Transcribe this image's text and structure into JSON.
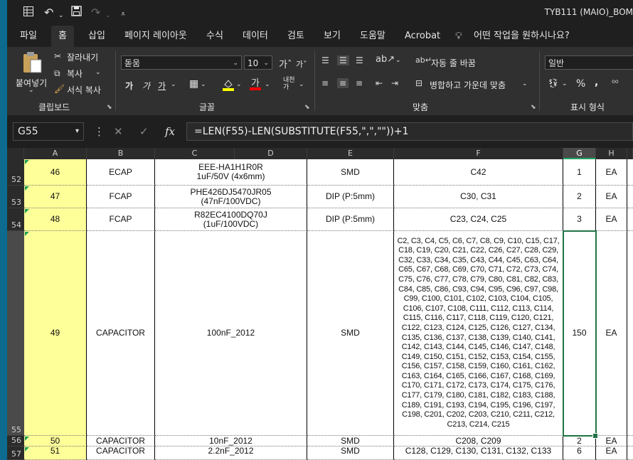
{
  "window": {
    "title": "TYB111 (MAIO)_BOM"
  },
  "quick_access": {
    "save_icon": "save-icon",
    "undo_icon": "undo-icon",
    "redo_icon": "redo-icon"
  },
  "tabs": [
    "파일",
    "홈",
    "삽입",
    "페이지 레이아웃",
    "수식",
    "데이터",
    "검토",
    "보기",
    "도움말",
    "Acrobat"
  ],
  "active_tab": "홈",
  "tell_me": "어떤 작업을 원하시나요?",
  "ribbon": {
    "clipboard": {
      "label": "클립보드",
      "paste": "붙여넣기",
      "cut": "잘라내기",
      "copy": "복사",
      "format_painter": "서식 복사"
    },
    "font": {
      "label": "글꼴",
      "font_name": "돋움",
      "font_size": "10"
    },
    "alignment": {
      "label": "맞춤",
      "wrap_text": "자동 줄 바꿈",
      "merge_center": "병합하고 가운데 맞춤"
    },
    "number": {
      "label": "표시 형식",
      "format": "일반"
    }
  },
  "formula_bar": {
    "name_box": "G55",
    "formula": "=LEN(F55)-LEN(SUBSTITUTE(F55,\",\",\"\"))+1",
    "fx": "fx"
  },
  "columns": [
    "A",
    "B",
    "C",
    "D",
    "E",
    "F",
    "G",
    "H"
  ],
  "selected_column": "G",
  "rows": [
    {
      "row": "52",
      "a": "46",
      "b": "ECAP",
      "c": "EEE-HA1H1R0R\n1uF/50V (4x6mm)",
      "e": "SMD",
      "f": "C42",
      "g": "1",
      "h": "EA"
    },
    {
      "row": "53",
      "a": "47",
      "b": "FCAP",
      "c": "PHE426DJ5470JR05\n(47nF/100VDC)",
      "e": "DIP (P:5mm)",
      "f": "C30, C31",
      "g": "2",
      "h": "EA"
    },
    {
      "row": "54",
      "a": "48",
      "b": "FCAP",
      "c": "R82EC4100DQ70J\n(1uF/100VDC)",
      "e": "DIP (P:5mm)",
      "f": "C23, C24, C25",
      "g": "3",
      "h": "EA"
    },
    {
      "row": "55",
      "a": "49",
      "b": "CAPACITOR",
      "c": "100nF_2012",
      "e": "SMD",
      "f": "C2, C3, C4, C5, C6, C7, C8, C9, C10, C15, C17, C18, C19, C20, C21, C22, C26, C27, C28, C29, C32, C33, C34, C35, C43, C44, C45, C63, C64, C65, C67, C68, C69, C70, C71, C72, C73, C74, C75, C76, C77, C78, C79, C80, C81, C82, C83, C84, C85, C86, C93, C94, C95, C96, C97, C98, C99, C100, C101, C102, C103, C104, C105, C106, C107, C108, C111, C112, C113, C114, C115, C116, C117, C118, C119, C120, C121, C122, C123, C124, C125, C126, C127, C134, C135, C136, C137, C138, C139, C140, C141, C142, C143, C144, C145, C146, C147, C148, C149, C150, C151, C152, C153, C154, C155, C156, C157, C158, C159, C160, C161, C162, C163, C164, C165, C166, C167, C168, C169, C170, C171, C172, C173, C174, C175, C176, C177, C179, C180, C181, C182, C183, C188, C189, C191, C193, C194, C195, C196, C197, C198, C201, C202, C203, C210, C211, C212, C213, C214, C215",
      "g": "150",
      "h": "EA"
    },
    {
      "row": "56",
      "a": "50",
      "b": "CAPACITOR",
      "c": "10nF_2012",
      "e": "SMD",
      "f": "C208, C209",
      "g": "2",
      "h": "EA"
    },
    {
      "row": "57",
      "a": "51",
      "b": "CAPACITOR",
      "c": "2.2nF_2012",
      "e": "SMD",
      "f": "C128, C129, C130, C131, C132, C133",
      "g": "6",
      "h": "EA"
    }
  ]
}
